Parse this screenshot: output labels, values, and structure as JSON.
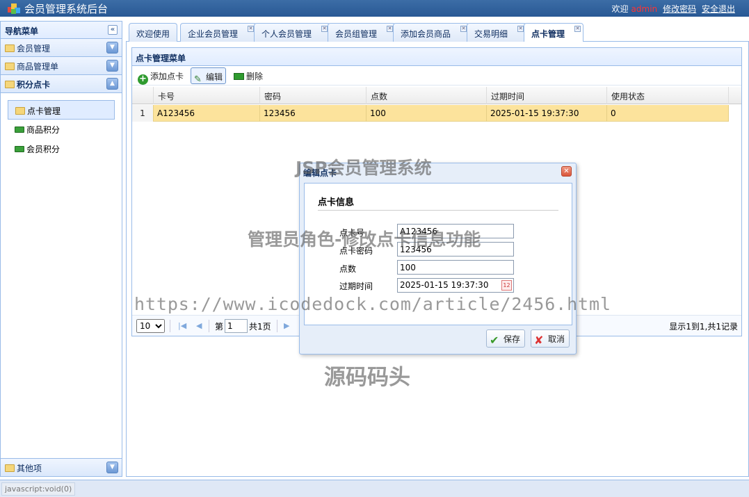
{
  "app": {
    "title": "会员管理系统后台",
    "welcome": "欢迎",
    "username": "admin",
    "change_password": "修改密码",
    "logout": "安全退出",
    "brand_color": "#2f609c",
    "username_color": "#ff3333"
  },
  "sidebar": {
    "header": "导航菜单",
    "groups": [
      {
        "label": "会员管理",
        "expanded": false
      },
      {
        "label": "商品管理单",
        "expanded": false
      },
      {
        "label": "积分点卡",
        "expanded": true
      },
      {
        "label": "其他项",
        "expanded": false
      }
    ],
    "subitems": [
      {
        "label": "点卡管理",
        "selected": true
      },
      {
        "label": "商品积分",
        "selected": false
      },
      {
        "label": "会员积分",
        "selected": false
      }
    ]
  },
  "tabs": [
    {
      "label": "欢迎使用",
      "closable": false
    },
    {
      "label": "企业会员管理",
      "closable": true
    },
    {
      "label": "个人会员管理",
      "closable": true
    },
    {
      "label": "会员组管理",
      "closable": true
    },
    {
      "label": "添加会员商品",
      "closable": true
    },
    {
      "label": "交易明细",
      "closable": true
    },
    {
      "label": "点卡管理",
      "closable": true,
      "active": true
    }
  ],
  "panel": {
    "title": "点卡管理菜单",
    "toolbar": {
      "add": "添加点卡",
      "edit": "编辑",
      "delete": "删除"
    },
    "columns": [
      "卡号",
      "密码",
      "点数",
      "过期时间",
      "使用状态"
    ],
    "rows": [
      {
        "num": "1",
        "card": "A123456",
        "password": "123456",
        "points": "100",
        "expire": "2025-01-15 19:37:30",
        "status": "0"
      }
    ],
    "pager": {
      "page_size": "10",
      "page_prefix": "第",
      "page_value": "1",
      "page_suffix": "共1页",
      "info": "显示1到1,共1记录"
    }
  },
  "dialog": {
    "title": "编辑点卡",
    "section": "点卡信息",
    "fields": {
      "card_label": "点卡号",
      "card_value": "A123456",
      "password_label": "点卡密码",
      "password_value": "123456",
      "points_label": "点数",
      "points_value": "100",
      "expire_label": "过期时间",
      "expire_value": "2025-01-15 19:37:30"
    },
    "save": "保存",
    "cancel": "取消"
  },
  "statusbar": {
    "text": "javascript:void(0)"
  },
  "watermarks": {
    "line1": "JSP会员管理系统",
    "line2": "管理员角色-修改点卡信息功能",
    "line3": "https://www.icodedock.com/article/2456.html",
    "line4": "源码码头"
  }
}
